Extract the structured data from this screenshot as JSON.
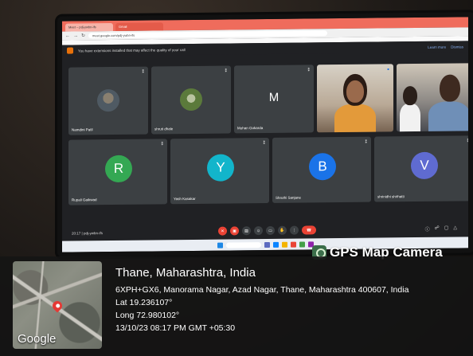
{
  "browser": {
    "tabs": [
      "Meet – pdj-ywbn-ifs",
      "Gmail"
    ],
    "url": "meet.google.com/pdj-ywbn-ifs"
  },
  "infobar": {
    "message": "You have extensions installed that may affect the quality of your call",
    "link1": "Learn more",
    "link2": "Dismiss"
  },
  "participants": [
    {
      "name": "Namdini Patil",
      "avatar": "photo"
    },
    {
      "name": "shruti dhale",
      "avatar": "photo"
    },
    {
      "name": "Mohan Gokarda",
      "initial": "M"
    },
    {
      "name": "Rupali Gaikwad",
      "initial": "R",
      "color": "#34a853"
    },
    {
      "name": "Yash Kasakar",
      "initial": "Y",
      "color": "#12b5cb"
    },
    {
      "name": "Shruthi Sanjane",
      "initial": "B",
      "color": "#1a73e8"
    },
    {
      "name": "shrinidhi shirhatti",
      "initial": "V",
      "color": "#5f6bd1"
    }
  ],
  "call": {
    "time": "20:17",
    "meeting_code": "pdj-ywbn-ifs"
  },
  "gps": {
    "badge": "GPS Map Camera",
    "place": "Thane, Maharashtra, India",
    "address": "6XPH+GX6, Manorama Nagar, Azad Nagar, Thane, Maharashtra 400607, India",
    "lat": "Lat 19.236107°",
    "long": "Long 72.980102°",
    "datetime": "13/10/23 08:17 PM GMT +05:30",
    "map_brand": "Google"
  }
}
